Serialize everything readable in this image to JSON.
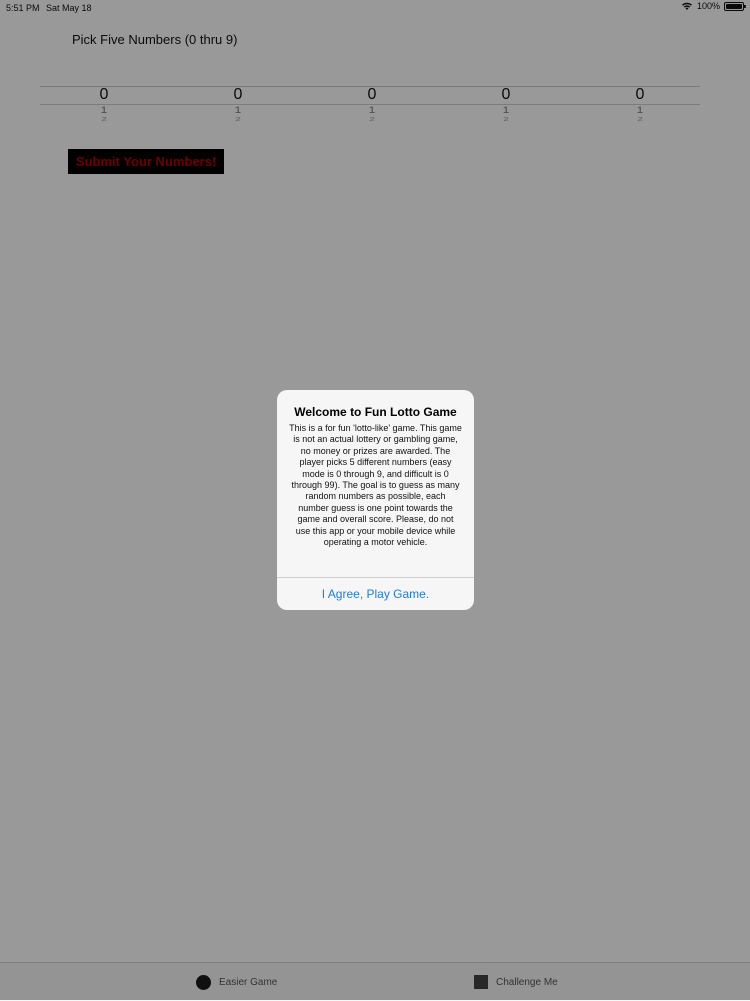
{
  "status_bar": {
    "time": "5:51 PM",
    "date": "Sat May 18",
    "battery": "100%"
  },
  "game": {
    "prompt": "Pick Five Numbers (0 thru 9)",
    "pickers": [
      {
        "selected": "0",
        "next": "1",
        "next2": "2"
      },
      {
        "selected": "0",
        "next": "1",
        "next2": "2"
      },
      {
        "selected": "0",
        "next": "1",
        "next2": "2"
      },
      {
        "selected": "0",
        "next": "1",
        "next2": "2"
      },
      {
        "selected": "0",
        "next": "1",
        "next2": "2"
      }
    ],
    "submit_label": "Submit Your Numbers!"
  },
  "tab_bar": {
    "easier_label": "Easier Game",
    "challenge_label": "Challenge Me"
  },
  "alert": {
    "title": "Welcome to Fun Lotto Game",
    "message": "This is a for fun 'lotto-like' game. This game is not an actual lottery or gambling game, no money or prizes are awarded. The player picks 5 different numbers (easy mode is 0 through 9, and difficult is 0 through 99). The goal is to guess as many random numbers as possible, each number guess is one point towards the game and overall score. Please, do not use this app or your mobile device while operating a motor vehicle.",
    "button_label": "I Agree, Play Game."
  },
  "colors": {
    "submit_text": "#b50000",
    "alert_button": "#1b7de0"
  }
}
